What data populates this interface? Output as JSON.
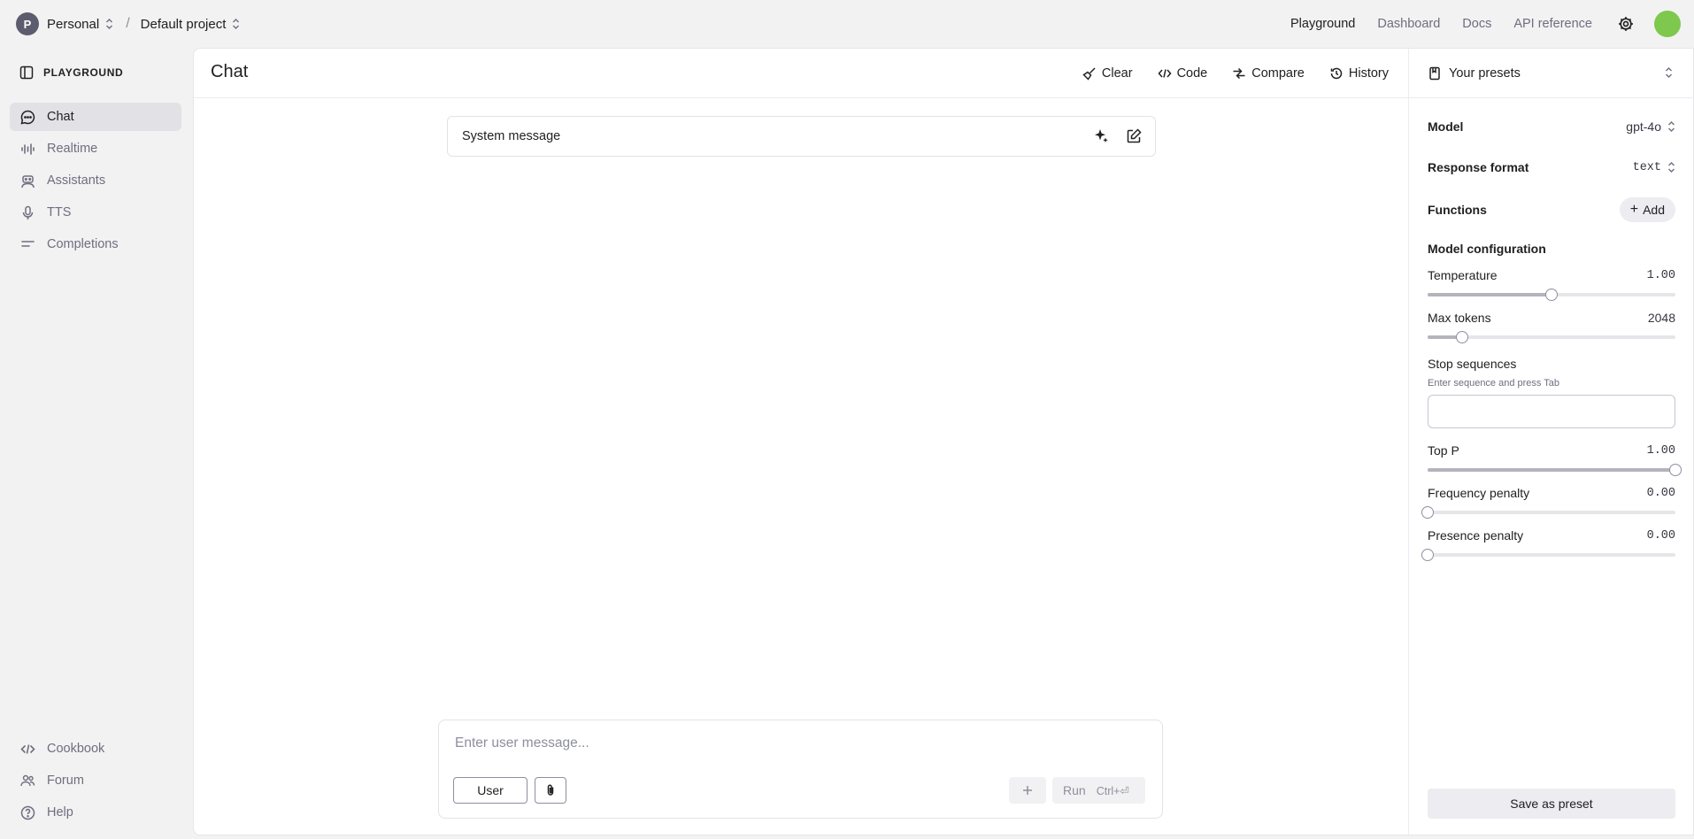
{
  "topbar": {
    "org_initial": "P",
    "org_name": "Personal",
    "separator": "/",
    "project_name": "Default project",
    "nav": [
      "Playground",
      "Dashboard",
      "Docs",
      "API reference"
    ]
  },
  "sidebar": {
    "header": "PLAYGROUND",
    "items": [
      {
        "label": "Chat",
        "icon": "chat-bubble-icon"
      },
      {
        "label": "Realtime",
        "icon": "waveform-icon"
      },
      {
        "label": "Assistants",
        "icon": "robot-icon"
      },
      {
        "label": "TTS",
        "icon": "microphone-icon"
      },
      {
        "label": "Completions",
        "icon": "lines-icon"
      }
    ],
    "footer": [
      {
        "label": "Cookbook",
        "icon": "code-icon"
      },
      {
        "label": "Forum",
        "icon": "people-icon"
      },
      {
        "label": "Help",
        "icon": "help-circle-icon"
      }
    ]
  },
  "main": {
    "title": "Chat",
    "actions": [
      "Clear",
      "Code",
      "Compare",
      "History"
    ],
    "system_message_label": "System message",
    "composer": {
      "placeholder": "Enter user message...",
      "role": "User",
      "run_label": "Run",
      "run_shortcut": "Ctrl+⏎"
    }
  },
  "settings": {
    "presets_label": "Your presets",
    "model_label": "Model",
    "model_value": "gpt-4o",
    "response_format_label": "Response format",
    "response_format_value": "text",
    "functions_label": "Functions",
    "add_label": "Add",
    "model_config_label": "Model configuration",
    "temperature": {
      "label": "Temperature",
      "value": "1.00",
      "fraction": 0.5
    },
    "max_tokens": {
      "label": "Max tokens",
      "value": "2048",
      "fraction": 0.14
    },
    "stop_sequences": {
      "label": "Stop sequences",
      "hint": "Enter sequence and press Tab"
    },
    "top_p": {
      "label": "Top P",
      "value": "1.00",
      "fraction": 1.0
    },
    "frequency_penalty": {
      "label": "Frequency penalty",
      "value": "0.00",
      "fraction": 0.0
    },
    "presence_penalty": {
      "label": "Presence penalty",
      "value": "0.00",
      "fraction": 0.0
    },
    "save_label": "Save as preset"
  }
}
